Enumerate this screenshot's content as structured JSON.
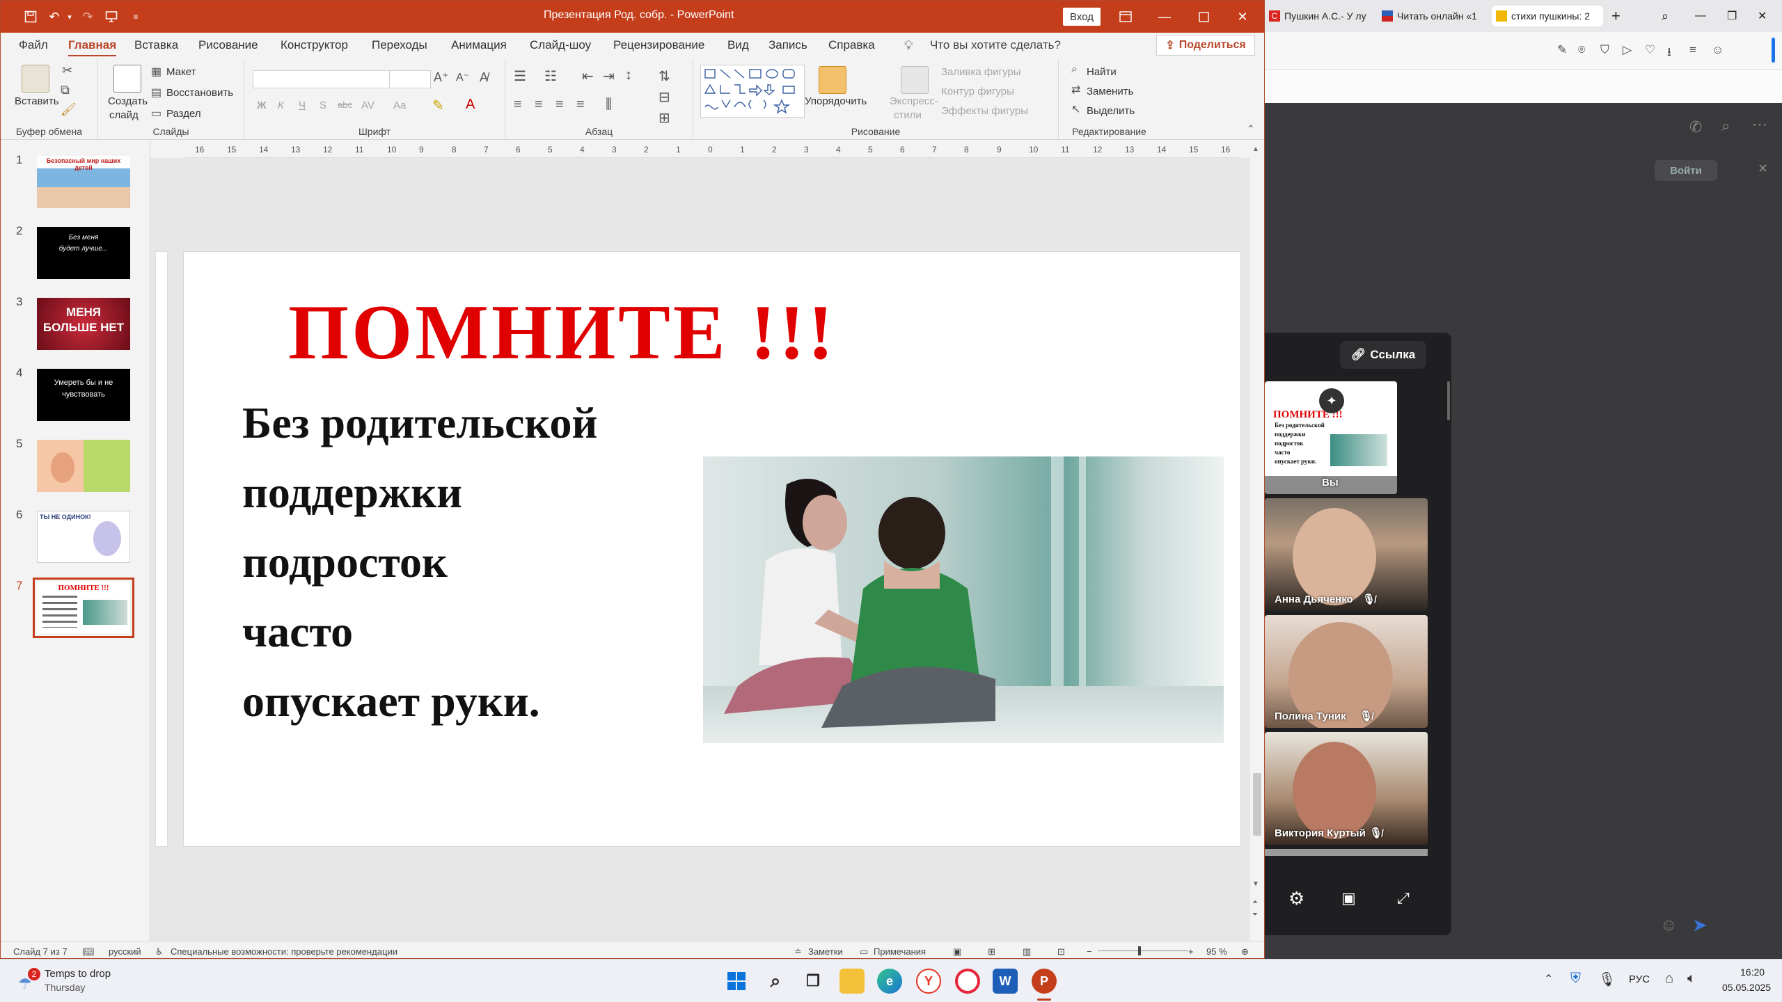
{
  "ppt": {
    "window_title": "Презентация Род. собр. - PowerPoint",
    "signin": "Вход",
    "tabs": [
      "Файл",
      "Главная",
      "Вставка",
      "Рисование",
      "Конструктор",
      "Переходы",
      "Анимация",
      "Слайд-шоу",
      "Рецензирование",
      "Вид",
      "Запись",
      "Справка"
    ],
    "tell_me": "Что вы хотите сделать?",
    "share": "Поделиться",
    "ribbon": {
      "paste": "Вставить",
      "clipboard": "Буфер обмена",
      "new_slide_1": "Создать",
      "new_slide_2": "слайд",
      "layout": "Макет",
      "reset": "Восстановить",
      "section": "Раздел",
      "slides": "Слайды",
      "font": "Шрифт",
      "paragraph": "Абзац",
      "arrange": "Упорядочить",
      "quick_styles_1": "Экспресс-",
      "quick_styles_2": "стили",
      "shape_fill": "Заливка фигуры",
      "shape_outline": "Контур фигуры",
      "shape_effects": "Эффекты фигуры",
      "drawing": "Рисование",
      "find": "Найти",
      "replace": "Заменить",
      "select": "Выделить",
      "editing": "Редактирование",
      "bold": "Ж",
      "italic": "К",
      "underline": "Ч",
      "shadow": "S",
      "strike": "abc",
      "spacing": "AV",
      "case": "Aa"
    },
    "thumbnails": [
      {
        "num": "1",
        "text": "Безопасный мир наших детей"
      },
      {
        "num": "2",
        "text": "Без меня будет лучше..."
      },
      {
        "num": "3",
        "text": "МЕНЯ БОЛЬШЕ НЕТ"
      },
      {
        "num": "4",
        "text": "Умереть бы и не чувствовать"
      },
      {
        "num": "5",
        "text": ""
      },
      {
        "num": "6",
        "text": "ТЫ НЕ ОДИНОК!"
      },
      {
        "num": "7",
        "text": "ПОМНИТЕ !!!"
      }
    ],
    "slide": {
      "title": "ПОМНИТЕ !!!",
      "body_lines": [
        "Без родительской",
        "поддержки",
        "подросток",
        "часто",
        "опускает руки."
      ]
    },
    "ruler_numbers": [
      "16",
      "15",
      "14",
      "13",
      "12",
      "11",
      "10",
      "9",
      "8",
      "7",
      "6",
      "5",
      "4",
      "3",
      "2",
      "1",
      "0",
      "1",
      "2",
      "3",
      "4",
      "5",
      "6",
      "7",
      "8",
      "9",
      "10",
      "11",
      "12",
      "13",
      "14",
      "15",
      "16"
    ],
    "status": {
      "slide_of": "Слайд 7 из 7",
      "language": "русский",
      "accessibility": "Специальные возможности: проверьте рекомендации",
      "notes": "Заметки",
      "comments": "Примечания",
      "zoom": "95 %"
    }
  },
  "browser": {
    "tabs": [
      "Пушкин А.С.- У лу",
      "Читать онлайн «1",
      "стихи пушкины: 2"
    ],
    "login": "Войти",
    "link_button": "Ссылка",
    "participants": [
      {
        "name": "Вы"
      },
      {
        "name": "Анна Дьяченко"
      },
      {
        "name": "Полина Туник"
      },
      {
        "name": "Виктория Куртый"
      }
    ],
    "self_preview": {
      "title": "ПОМНИТЕ !!!",
      "lines": [
        "Без родительской",
        "поддержки",
        "подросток",
        "часто",
        "опускает руки."
      ]
    }
  },
  "taskbar": {
    "weather_temp": "Temps to drop",
    "weather_day": "Thursday",
    "weather_badge": "2",
    "lang": "РУС",
    "time": "16:20",
    "date": "05.05.2025"
  },
  "colors": {
    "ppt_accent": "#c43e1c",
    "slide_title": "#e00000"
  }
}
